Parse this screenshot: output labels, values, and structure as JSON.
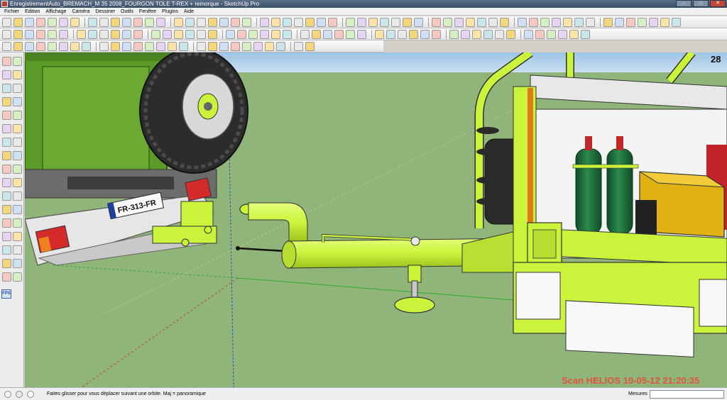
{
  "window": {
    "title": "EnregistrementAuto_BREMACH_M 35 2008_FOURGON TOLE T-REX + remorque - SketchUp Pro"
  },
  "menu": {
    "items": [
      "Fichier",
      "Edition",
      "Affichage",
      "Caméra",
      "Dessiner",
      "Outils",
      "Fenêtre",
      "Plugins",
      "Aide"
    ]
  },
  "toolbar_icons": {
    "row1": [
      "select-icon",
      "pencil-icon",
      "line-icon",
      "rectangle-icon",
      "circle-icon",
      "polygon-icon",
      "eraser-icon",
      "paint-icon",
      "move-icon",
      "push-pull-icon",
      "rotate-icon",
      "follow-me-icon",
      "scale-icon",
      "offset-icon",
      "tape-icon",
      "protractor-icon",
      "axes-icon",
      "dimension-icon",
      "text-icon",
      "3d-text-icon",
      "orbit-icon",
      "pan-icon",
      "zoom-icon",
      "zoom-window-icon",
      "zoom-extents-icon",
      "previous-view-icon",
      "next-view-icon",
      "iso-view-icon",
      "top-view-icon",
      "front-view-icon",
      "right-view-icon",
      "back-view-icon",
      "left-view-icon",
      "xray-icon",
      "wireframe-icon",
      "hidden-line-icon",
      "shaded-icon",
      "textured-icon",
      "monochrome-icon",
      "section-plane-icon",
      "section-cut-icon",
      "shadow-icon",
      "fog-icon",
      "camera-position-icon",
      "walk-icon",
      "look-around-icon",
      "components-icon",
      "materials-icon",
      "styles-icon",
      "layers-icon",
      "outliner-icon",
      "scenes-icon",
      "model-info-icon",
      "entity-info-icon",
      "print-icon",
      "export-icon"
    ],
    "row2": [
      "undo-icon",
      "redo-icon",
      "cut-icon",
      "copy-icon",
      "paste-icon",
      "erase-icon",
      "make-component-icon",
      "group-icon",
      "explode-icon",
      "intersect-icon",
      "union-icon",
      "subtract-icon",
      "trim-icon",
      "split-icon",
      "outer-shell-icon",
      "solid-inspector-icon",
      "sandbox-icon",
      "smoove-icon",
      "stamp-icon",
      "drape-icon",
      "add-detail-icon",
      "flip-edge-icon",
      "get-models-icon",
      "share-model-icon",
      "upload-icon",
      "photo-match-icon",
      "geo-location-icon",
      "toggle-terrain-icon",
      "add-location-icon",
      "google-earth-icon",
      "extension-icon",
      "ruby-console-icon",
      "plugin-a-icon",
      "plugin-b-icon",
      "plugin-c-icon",
      "plugin-d-icon",
      "plugin-e-icon",
      "plugin-f-icon",
      "plugin-g-icon",
      "plugin-h-icon",
      "plugin-i-icon",
      "plugin-j-icon",
      "plugin-k-icon",
      "plugin-l-icon",
      "plugin-m-icon",
      "plugin-n-icon",
      "plugin-o-icon",
      "plugin-p-icon"
    ],
    "row3": [
      "new-icon",
      "open-icon",
      "save-icon",
      "bulb-icon",
      "display-icon",
      "sphere-icon",
      "box-icon",
      "camera-icon",
      "render-icon",
      "material-icon",
      "layer-icon",
      "light-icon",
      "pyramid-icon",
      "cylinder-icon",
      "tube-icon",
      "weld-icon",
      "curve-icon",
      "bezier-icon",
      "spline-icon",
      "arc-icon",
      "fillet-icon",
      "chamfer-icon",
      "extrude-icon",
      "loft-icon",
      "sweep-icon",
      "joint-push-pull-icon"
    ]
  },
  "left_tools": [
    "select-tool-icon",
    "make-component-tool-icon",
    "paint-bucket-tool-icon",
    "eraser-tool-icon",
    "rectangle-tool-icon",
    "line-tool-icon",
    "circle-tool-icon",
    "arc-tool-icon",
    "polygon-tool-icon",
    "freehand-tool-icon",
    "move-tool-icon",
    "push-pull-tool-icon",
    "rotate-tool-icon",
    "follow-me-tool-icon",
    "scale-tool-icon",
    "offset-tool-icon",
    "tape-measure-tool-icon",
    "dimension-tool-icon",
    "protractor-tool-icon",
    "text-tool-icon",
    "axes-tool-icon",
    "3d-text-tool-icon",
    "orbit-tool-icon",
    "pan-tool-icon",
    "zoom-tool-icon",
    "zoom-window-tool-icon",
    "zoom-extents-tool-icon",
    "previous-tool-icon",
    "position-camera-tool-icon",
    "walk-tool-icon",
    "look-around-tool-icon",
    "section-plane-tool-icon",
    "sandbox-tool-icon",
    "detail-tool-icon"
  ],
  "left_fps": "FPS",
  "viewport": {
    "scene_number": "28",
    "plate_text": "FR-313-FR",
    "watermark": "Scan HELIOS 10-05-12 21:20:35",
    "colors": {
      "sky": "#9dc4e6",
      "ground": "#8fb57a",
      "body": "#ccf33c",
      "truck": "#5a9a26",
      "cylinder": "#1e6b3a",
      "generator": "#e0b214"
    }
  },
  "status": {
    "hint": "Faites glisser pour vous déplacer suivant une orbite.  Maj = panoramique",
    "measure_label": "Mesures"
  }
}
